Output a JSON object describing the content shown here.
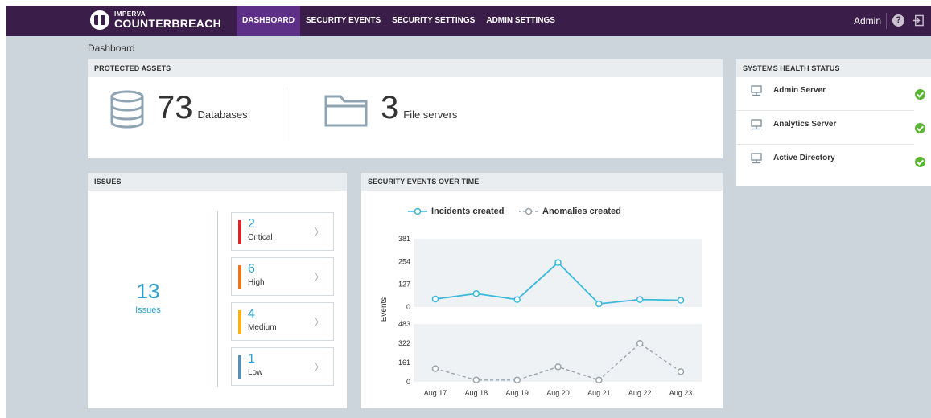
{
  "brand": {
    "small": "IMPERVA",
    "big": "COUNTERBREACH"
  },
  "nav": [
    {
      "label": "DASHBOARD",
      "active": true
    },
    {
      "label": "SECURITY EVENTS",
      "active": false
    },
    {
      "label": "SECURITY SETTINGS",
      "active": false
    },
    {
      "label": "ADMIN SETTINGS",
      "active": false
    }
  ],
  "user": {
    "name": "Admin"
  },
  "icons": {
    "help": "help-icon",
    "logout": "logout-icon"
  },
  "breadcrumb": "Dashboard",
  "protected_assets": {
    "title": "PROTECTED ASSETS",
    "databases": {
      "count": "73",
      "label": "Databases",
      "icon": "database-icon"
    },
    "file_servers": {
      "count": "3",
      "label": "File servers",
      "icon": "folder-icon"
    }
  },
  "issues": {
    "title": "ISSUES",
    "total": "13",
    "total_label": "Issues",
    "severities": [
      {
        "count": "2",
        "label": "Critical",
        "color": "#d9262e"
      },
      {
        "count": "6",
        "label": "High",
        "color": "#ee7622"
      },
      {
        "count": "4",
        "label": "Medium",
        "color": "#f6b21a"
      },
      {
        "count": "1",
        "label": "Low",
        "color": "#5b8fae"
      }
    ]
  },
  "events_chart": {
    "title": "SECURITY EVENTS OVER TIME",
    "ylabel": "Events"
  },
  "chart_data": {
    "type": "line",
    "categories": [
      "Aug 17",
      "Aug 18",
      "Aug 19",
      "Aug 20",
      "Aug 21",
      "Aug 22",
      "Aug 23"
    ],
    "series": [
      {
        "name": "Incidents created",
        "values": [
          45,
          75,
          42,
          248,
          18,
          42,
          38
        ],
        "color": "#3ab8dd",
        "ticks": [
          "381",
          "254",
          "127",
          "0"
        ],
        "ylim": [
          0,
          381
        ]
      },
      {
        "name": "Anomalies created",
        "values": [
          110,
          15,
          15,
          125,
          15,
          320,
          85
        ],
        "color": "#9aa4aa",
        "ticks": [
          "483",
          "322",
          "161",
          "0"
        ],
        "ylim": [
          0,
          483
        ]
      }
    ],
    "xlabel": "",
    "ylabel": "Events",
    "legend": "top"
  },
  "health": {
    "title": "SYSTEMS HEALTH STATUS",
    "items": [
      {
        "label": "Admin Server",
        "status": "ok"
      },
      {
        "label": "Analytics Server",
        "status": "ok"
      },
      {
        "label": "Active Directory",
        "status": "ok"
      }
    ]
  }
}
